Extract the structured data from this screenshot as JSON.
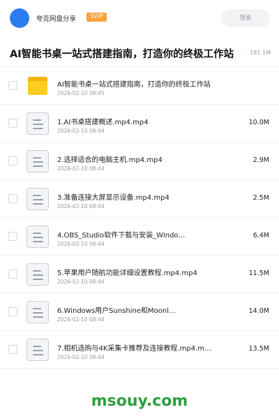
{
  "header": {
    "user_name": "夸克网盘分享",
    "vip_badge": "SVIP",
    "search_placeholder": "搜索"
  },
  "title_bar": {
    "title": "AI智能书桌一站式搭建指南，打造你的终极工作站",
    "total_size": "181.1M"
  },
  "files": [
    {
      "type": "folder",
      "name": "AI智能书桌一站式搭建指南，打造你的终极工作站",
      "date": "2026-02-10 08:45",
      "size": ""
    },
    {
      "type": "video",
      "name": "1.AI书桌搭建概述.mp4.mp4",
      "date": "2026-02-10 08:44",
      "size": "10.0M"
    },
    {
      "type": "video",
      "name": "2.选择适合的电脑主机.mp4.mp4",
      "date": "2026-02-10 08:44",
      "size": "2.9M"
    },
    {
      "type": "video",
      "name": "3.准备连接大屏显示设备.mp4.mp4",
      "date": "2026-02-10 08:44",
      "size": "2.5M"
    },
    {
      "type": "video",
      "name": "4.OBS_Studio软件下载与安装_Windo…",
      "date": "2026-02-10 08:44",
      "size": "6.4M"
    },
    {
      "type": "video",
      "name": "5.苹果用户随航功能详细设置教程.mp4.mp4",
      "date": "2026-02-10 08:44",
      "size": "11.5M"
    },
    {
      "type": "video",
      "name": "6.Windows用户Sunshine和Moonl…",
      "date": "2026-02-10 08:44",
      "size": "14.0M"
    },
    {
      "type": "video",
      "name": "7.相机选购与4K采集卡推荐及连接教程.mp4.m…",
      "date": "2026-02-10 08:44",
      "size": "13.5M"
    }
  ],
  "watermark": "msouy.com"
}
